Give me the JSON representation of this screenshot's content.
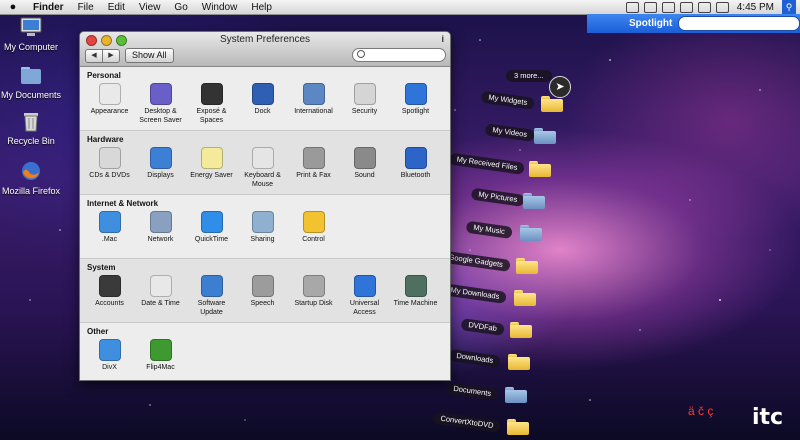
{
  "menubar": {
    "apple": "",
    "items": [
      "Finder",
      "File",
      "Edit",
      "View",
      "Go",
      "Window",
      "Help"
    ],
    "clock": "4:45 PM"
  },
  "spotlight": {
    "label": "Spotlight",
    "placeholder": ""
  },
  "desktop_icons": [
    {
      "label": "My Computer",
      "icon": "computer-icon"
    },
    {
      "label": "My Documents",
      "icon": "documents-folder-icon"
    },
    {
      "label": "Recycle Bin",
      "icon": "trash-icon"
    },
    {
      "label": "Mozilla Firefox",
      "icon": "firefox-icon"
    }
  ],
  "window": {
    "title": "System Preferences",
    "show_all": "Show All",
    "search_placeholder": "",
    "sections": [
      {
        "title": "Personal",
        "items": [
          {
            "label": "Appearance",
            "icon": "appearance-icon",
            "color": "#e9e9e9"
          },
          {
            "label": "Desktop &\nScreen Saver",
            "icon": "desktop-icon",
            "color": "#6a5fc8"
          },
          {
            "label": "Exposé &\nSpaces",
            "icon": "expose-icon",
            "color": "#333333"
          },
          {
            "label": "Dock",
            "icon": "dock-icon",
            "color": "#2f5fb5"
          },
          {
            "label": "International",
            "icon": "international-icon",
            "color": "#5c86c4"
          },
          {
            "label": "Security",
            "icon": "security-icon",
            "color": "#d5d5d5"
          },
          {
            "label": "Spotlight",
            "icon": "spotlight-icon",
            "color": "#2f74d8"
          }
        ]
      },
      {
        "title": "Hardware",
        "items": [
          {
            "label": "CDs & DVDs",
            "icon": "cd-icon",
            "color": "#d8d8d8"
          },
          {
            "label": "Displays",
            "icon": "display-icon",
            "color": "#3e7fd6"
          },
          {
            "label": "Energy Saver",
            "icon": "bulb-icon",
            "color": "#f3ea9a"
          },
          {
            "label": "Keyboard &\nMouse",
            "icon": "keyboard-icon",
            "color": "#e5e5e5"
          },
          {
            "label": "Print & Fax",
            "icon": "printer-icon",
            "color": "#9a9a9a"
          },
          {
            "label": "Sound",
            "icon": "speaker-icon",
            "color": "#8a8a8a"
          },
          {
            "label": "Bluetooth",
            "icon": "bluetooth-icon",
            "color": "#2d64c8"
          }
        ]
      },
      {
        "title": "Internet & Network",
        "items": [
          {
            "label": ".Mac",
            "icon": "dotmac-icon",
            "color": "#3f8fe0"
          },
          {
            "label": "Network",
            "icon": "network-icon",
            "color": "#8aa0c0"
          },
          {
            "label": "QuickTime",
            "icon": "quicktime-icon",
            "color": "#2f8fe8"
          },
          {
            "label": "Sharing",
            "icon": "sharing-icon",
            "color": "#8fb0d0"
          },
          {
            "label": "Control",
            "icon": "control-icon",
            "color": "#f2c230"
          }
        ]
      },
      {
        "title": "System",
        "items": [
          {
            "label": "Accounts",
            "icon": "accounts-icon",
            "color": "#3a3a3a"
          },
          {
            "label": "Date & Time",
            "icon": "clock-icon",
            "color": "#e8e8e8"
          },
          {
            "label": "Software\nUpdate",
            "icon": "software-update-icon",
            "color": "#3c7fd0"
          },
          {
            "label": "Speech",
            "icon": "microphone-icon",
            "color": "#9c9c9c"
          },
          {
            "label": "Startup Disk",
            "icon": "disk-icon",
            "color": "#a8a8a8"
          },
          {
            "label": "Universal\nAccess",
            "icon": "universal-access-icon",
            "color": "#2f74d8"
          },
          {
            "label": "Time Machine",
            "icon": "time-machine-icon",
            "color": "#4f6f60"
          }
        ]
      },
      {
        "title": "Other",
        "items": [
          {
            "label": "DivX",
            "icon": "divx-icon",
            "color": "#3f8fe0"
          },
          {
            "label": "Flip4Mac",
            "icon": "flip4mac-icon",
            "color": "#3e9a30"
          }
        ]
      }
    ]
  },
  "stack": {
    "more": "3 more...",
    "items": [
      {
        "label": "My Widgets",
        "folder": "yellow"
      },
      {
        "label": "My Videos",
        "folder": "blue"
      },
      {
        "label": "My Received Files",
        "folder": "yellow"
      },
      {
        "label": "My Pictures",
        "folder": "blue"
      },
      {
        "label": "My Music",
        "folder": "blue"
      },
      {
        "label": "My Google Gadgets",
        "folder": "yellow"
      },
      {
        "label": "My Downloads",
        "folder": "yellow"
      },
      {
        "label": "DVDFab",
        "folder": "yellow"
      },
      {
        "label": "Downloads",
        "folder": "yellow"
      },
      {
        "label": "Documents",
        "folder": "blue"
      },
      {
        "label": "ConvertXtoDVD",
        "folder": "yellow"
      }
    ]
  },
  "watermark": {
    "glyphs": "ä č ç",
    "logo": "itc"
  }
}
